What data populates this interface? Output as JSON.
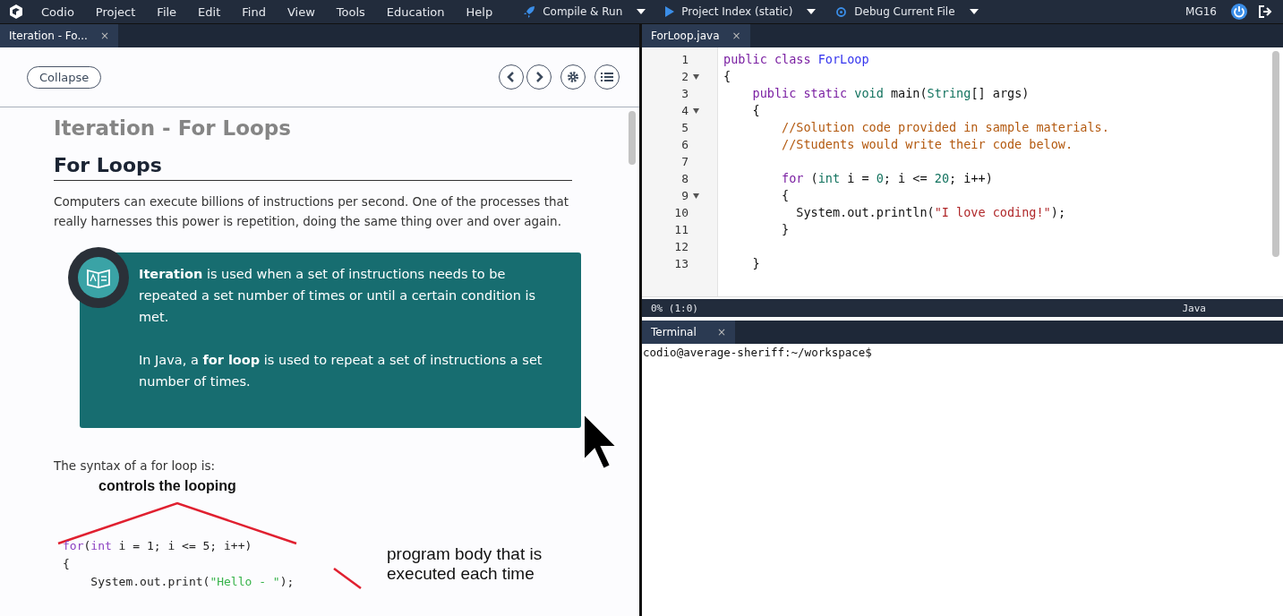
{
  "menubar": {
    "menus": [
      "Codio",
      "Project",
      "File",
      "Edit",
      "Find",
      "View",
      "Tools",
      "Education",
      "Help"
    ],
    "actions": [
      {
        "label": "Compile & Run",
        "kind": "rocket"
      },
      {
        "label": "Project Index (static)",
        "kind": "play"
      },
      {
        "label": "Debug Current File",
        "kind": "debug"
      }
    ],
    "user": "MG16"
  },
  "guide": {
    "tab": {
      "label": "Iteration - Fo...",
      "selected": true,
      "close": "×"
    },
    "collapse": "Collapse",
    "page_title": "Iteration - For Loops",
    "heading": "For Loops",
    "intro": "Computers can execute billions of instructions per second. One of the processes that really harnesses this power is repetition, doing the same thing over and over again.",
    "callout": [
      "**Iteration** is used when a set of instructions needs to be repeated a set number of times or until a certain condition is met.",
      "In Java, a **for loop** is used to repeat a set of instructions a set number of times."
    ],
    "syntax_intro": "The syntax of a for loop is:",
    "figure": {
      "top_label": "controls the looping",
      "code": [
        [
          {
            "kind": "kw",
            "text": "for"
          },
          {
            "kind": "plain",
            "text": "("
          },
          {
            "kind": "kw",
            "text": "int"
          },
          {
            "kind": "plain",
            "text": " i = 1; i <= 5; i++)"
          }
        ],
        [
          {
            "kind": "plain",
            "text": "{"
          }
        ],
        [
          {
            "kind": "plain",
            "text": "    System.out.print("
          },
          {
            "kind": "str",
            "text": "\"Hello - \""
          },
          {
            "kind": "plain",
            "text": ");"
          }
        ]
      ],
      "side_label": [
        "program body that is",
        "executed each time"
      ]
    }
  },
  "editor": {
    "tab": {
      "label": "ForLoop.java",
      "selected": true,
      "close": "×"
    },
    "lines": [
      {
        "number": "1",
        "fold": false,
        "tokens": [
          {
            "kind": "kw",
            "text": "public class "
          },
          {
            "kind": "cls",
            "text": "ForLoop"
          }
        ]
      },
      {
        "number": "2",
        "fold": true,
        "tokens": [
          {
            "kind": "plain",
            "text": "{"
          }
        ]
      },
      {
        "number": "3",
        "fold": false,
        "tokens": [
          {
            "kind": "kw",
            "text": "    public static "
          },
          {
            "kind": "type",
            "text": "void"
          },
          {
            "kind": "plain",
            "text": " main("
          },
          {
            "kind": "type",
            "text": "String"
          },
          {
            "kind": "plain",
            "text": "[] args)"
          }
        ]
      },
      {
        "number": "4",
        "fold": true,
        "tokens": [
          {
            "kind": "plain",
            "text": "    {"
          }
        ]
      },
      {
        "number": "5",
        "fold": false,
        "tokens": [
          {
            "kind": "cmt",
            "text": "        //Solution code provided in sample materials."
          }
        ]
      },
      {
        "number": "6",
        "fold": false,
        "tokens": [
          {
            "kind": "cmt",
            "text": "        //Students would write their code below."
          }
        ]
      },
      {
        "number": "7",
        "fold": false
      },
      {
        "number": "8",
        "fold": false,
        "tokens": [
          {
            "kind": "kw",
            "text": "        for"
          },
          {
            "kind": "plain",
            "text": " ("
          },
          {
            "kind": "type",
            "text": "int"
          },
          {
            "kind": "plain",
            "text": " i = "
          },
          {
            "kind": "num",
            "text": "0"
          },
          {
            "kind": "plain",
            "text": "; i <= "
          },
          {
            "kind": "num",
            "text": "20"
          },
          {
            "kind": "plain",
            "text": "; i++)"
          }
        ]
      },
      {
        "number": "9",
        "fold": true,
        "tokens": [
          {
            "kind": "plain",
            "text": "        {"
          }
        ]
      },
      {
        "number": "10",
        "fold": false,
        "tokens": [
          {
            "kind": "plain",
            "text": "          System.out.println("
          },
          {
            "kind": "str",
            "text": "\"I love coding!\""
          },
          {
            "kind": "plain",
            "text": ");"
          }
        ]
      },
      {
        "number": "11",
        "fold": false,
        "tokens": [
          {
            "kind": "plain",
            "text": "        }"
          }
        ]
      },
      {
        "number": "12",
        "fold": false
      },
      {
        "number": "13",
        "fold": false,
        "tokens": [
          {
            "kind": "plain",
            "text": "    }"
          }
        ]
      }
    ],
    "status": {
      "position": "0% (1:0)",
      "language": "Java"
    }
  },
  "terminal": {
    "tab": {
      "label": "Terminal",
      "selected": true,
      "close": "×"
    },
    "prompt": "codio@average-sheriff:~/workspace$"
  }
}
